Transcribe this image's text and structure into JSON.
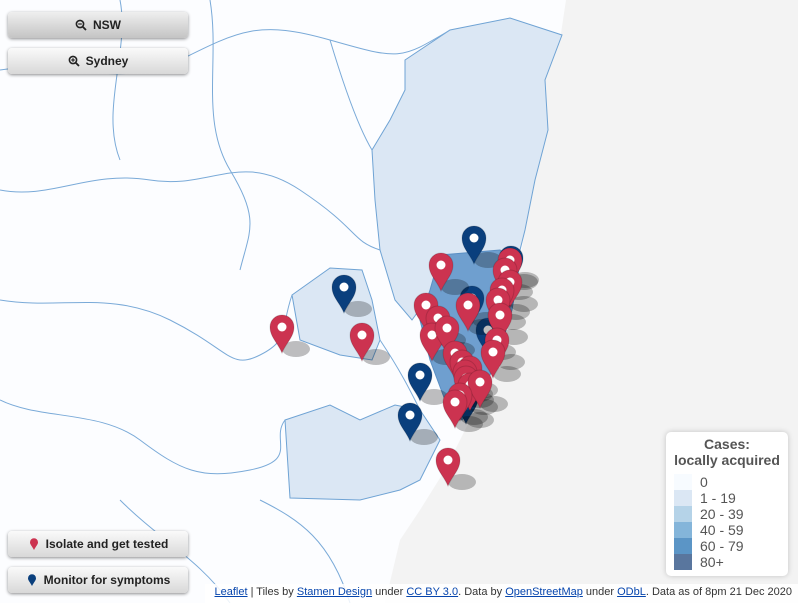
{
  "controls": {
    "nsw_label": "NSW",
    "sydney_label": "Sydney",
    "isolate_label": "Isolate and get tested",
    "monitor_label": "Monitor for symptoms"
  },
  "legend": {
    "title_line1": "Cases:",
    "title_line2": "locally acquired",
    "items": [
      {
        "label": "0",
        "color": "#f7fbff"
      },
      {
        "label": "1 - 19",
        "color": "#dbe7f4"
      },
      {
        "label": "20 - 39",
        "color": "#b5d3e8"
      },
      {
        "label": "40 - 59",
        "color": "#84b5da"
      },
      {
        "label": "60 - 79",
        "color": "#5b95c6"
      },
      {
        "label": "80+",
        "color": "#59769e"
      }
    ]
  },
  "attribution": {
    "leaflet": "Leaflet",
    "sep1": " | Tiles by ",
    "stamen": "Stamen Design",
    "under1": " under ",
    "ccby": "CC BY 3.0",
    "data_by": ". Data by ",
    "osm": "OpenStreetMap",
    "under2": " under ",
    "odbl": "ODbL",
    "data_as_of": ". Data as of 8pm 21 Dec 2020"
  },
  "colors": {
    "isolate_marker": "#cc3350",
    "monitor_marker": "#0a3f7d",
    "sea": "#f3f3f3"
  }
}
